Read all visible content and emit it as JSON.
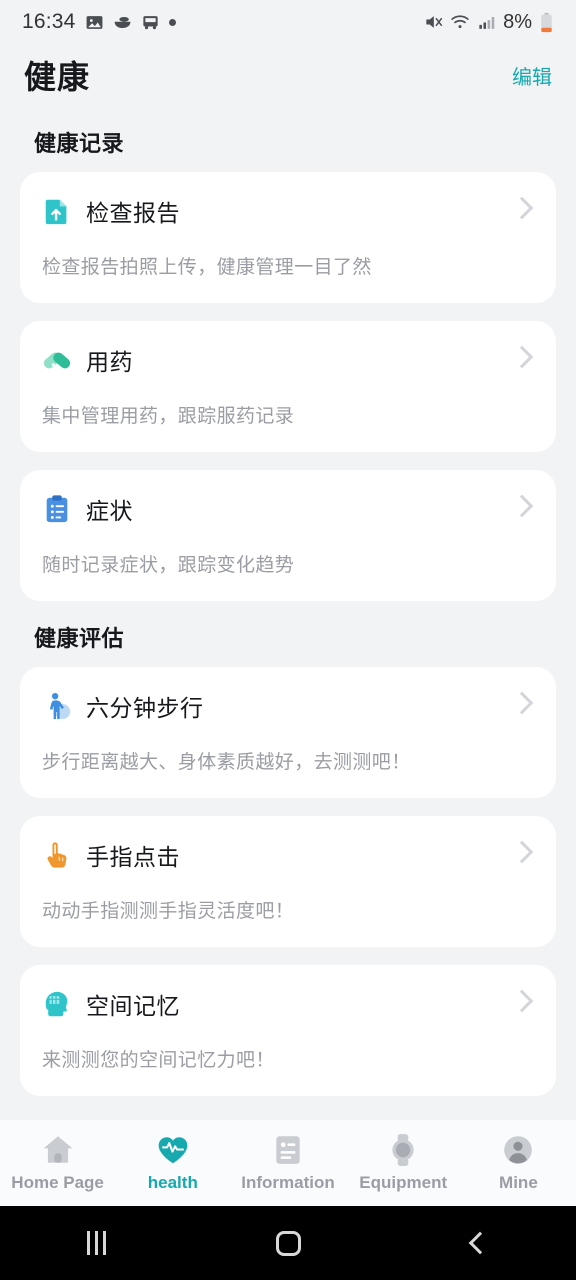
{
  "status_bar": {
    "time": "16:34",
    "battery_percent": "8%",
    "left_icons": [
      "image-icon",
      "bowl-icon",
      "bus-icon",
      "dot-indicator"
    ],
    "right_icons": [
      "mute-icon",
      "wifi-icon",
      "signal-icon",
      "battery-icon"
    ]
  },
  "header": {
    "title": "健康",
    "edit_label": "编辑",
    "accent_color": "#17a9ae"
  },
  "sections": [
    {
      "title": "健康记录",
      "cards": [
        {
          "title": "检查报告",
          "desc": "检查报告拍照上传，健康管理一目了然",
          "icon": "report-upload-icon",
          "icon_color": "#2ec4c9"
        },
        {
          "title": "用药",
          "desc": "集中管理用药，跟踪服药记录",
          "icon": "pill-icon",
          "icon_color": "#2ebd96"
        },
        {
          "title": "症状",
          "desc": "随时记录症状，跟踪变化趋势",
          "icon": "clipboard-icon",
          "icon_color": "#4a90e2"
        }
      ]
    },
    {
      "title": "健康评估",
      "cards": [
        {
          "title": "六分钟步行",
          "desc": "步行距离越大、身体素质越好，去测测吧！",
          "icon": "walking-person-icon",
          "icon_color": "#3f8ee0"
        },
        {
          "title": "手指点击",
          "desc": "动动手指测测手指灵活度吧！",
          "icon": "pointing-hand-icon",
          "icon_color": "#f0962e"
        },
        {
          "title": "空间记忆",
          "desc": "来测测您的空间记忆力吧！",
          "icon": "brain-head-icon",
          "icon_color": "#2ec4c9"
        }
      ]
    }
  ],
  "tabbar": {
    "active_index": 1,
    "items": [
      {
        "label": "Home Page",
        "icon": "home-icon"
      },
      {
        "label": "health",
        "icon": "heart-pulse-icon"
      },
      {
        "label": "Information",
        "icon": "info-card-icon"
      },
      {
        "label": "Equipment",
        "icon": "watch-icon"
      },
      {
        "label": "Mine",
        "icon": "person-icon"
      }
    ]
  },
  "android_nav": {
    "recent_label": "recent-apps",
    "home_label": "home",
    "back_label": "back"
  }
}
